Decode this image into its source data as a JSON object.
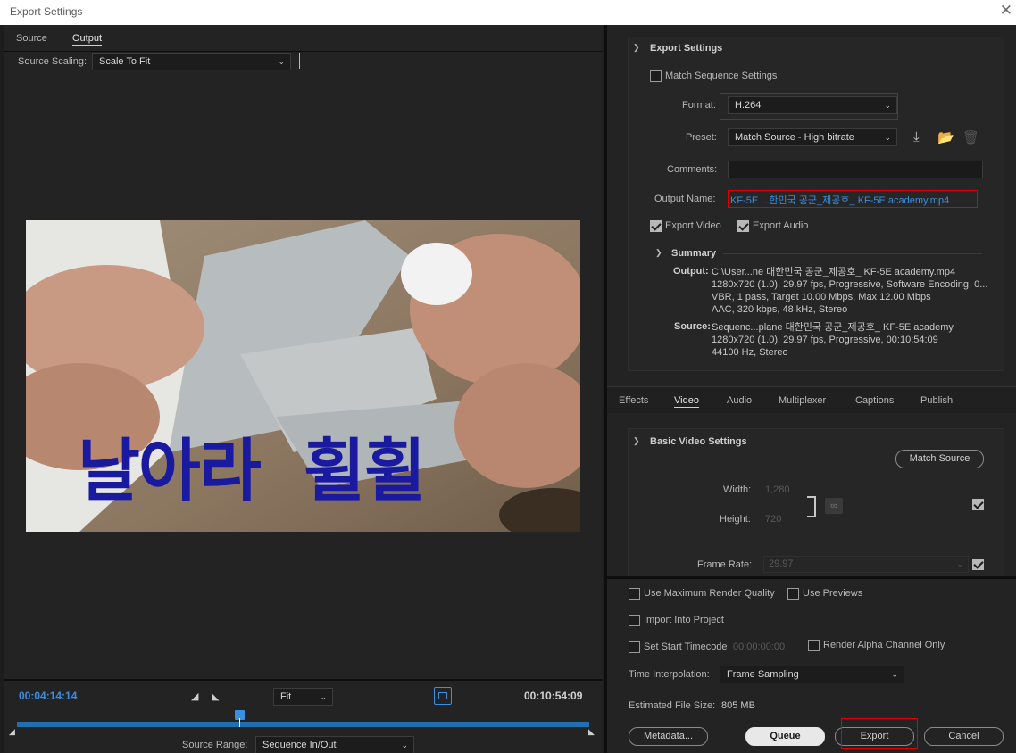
{
  "window": {
    "title": "Export Settings",
    "close": "✕"
  },
  "left": {
    "tabs": [
      "Source",
      "Output"
    ],
    "source_scaling_label": "Source Scaling:",
    "source_scaling_value": "Scale To Fit",
    "overlay_text": "날아라  휠휠",
    "current_time": "00:04:14:14",
    "duration": "00:10:54:09",
    "zoom": "Fit",
    "playhead_progress": 0.39,
    "source_range_label": "Source Range:",
    "source_range_value": "Sequence In/Out"
  },
  "export_settings": {
    "header": "Export Settings",
    "match_sequence": "Match Sequence Settings",
    "format_label": "Format:",
    "format_value": "H.264",
    "preset_label": "Preset:",
    "preset_value": "Match Source - High bitrate",
    "comments_label": "Comments:",
    "output_name_label": "Output Name:",
    "output_name_value": "KF-5E  ...한민국 공군_제공호_ KF-5E academy.mp4",
    "export_video": "Export Video",
    "export_audio": "Export Audio",
    "summary_header": "Summary",
    "output_label": "Output:",
    "output_lines": [
      "C:\\User...ne 대한민국 공군_제공호_ KF-5E academy.mp4",
      "1280x720 (1.0), 29.97 fps, Progressive, Software Encoding, 0...",
      "VBR, 1 pass, Target 10.00 Mbps, Max 12.00 Mbps",
      "AAC, 320 kbps, 48 kHz, Stereo"
    ],
    "source_label": "Source:",
    "source_lines": [
      "Sequenc...plane 대한민국 공군_제공호_ KF-5E academy",
      "1280x720 (1.0), 29.97 fps, Progressive, 00:10:54:09",
      "44100 Hz, Stereo"
    ]
  },
  "tabs2": [
    "Effects",
    "Video",
    "Audio",
    "Multiplexer",
    "Captions",
    "Publish"
  ],
  "video": {
    "header": "Basic Video Settings",
    "match_source": "Match Source",
    "width_label": "Width:",
    "width_value": "1,280",
    "height_label": "Height:",
    "height_value": "720",
    "frame_rate_label": "Frame Rate:",
    "frame_rate_value": "29.97"
  },
  "bottom": {
    "max_render": "Use Maximum Render Quality",
    "use_previews": "Use Previews",
    "import_project": "Import Into Project",
    "set_start_tc": "Set Start Timecode",
    "start_tc_value": "00:00:00:00",
    "render_alpha": "Render Alpha Channel Only",
    "time_interp_label": "Time Interpolation:",
    "time_interp_value": "Frame Sampling",
    "est_size_label": "Estimated File Size:",
    "est_size_value": "805 MB",
    "metadata": "Metadata...",
    "queue": "Queue",
    "export": "Export",
    "cancel": "Cancel"
  },
  "colors": {
    "accent": "#3b8ee0",
    "highlight": "#e00000",
    "overlay_text": "#1a1aa0"
  }
}
